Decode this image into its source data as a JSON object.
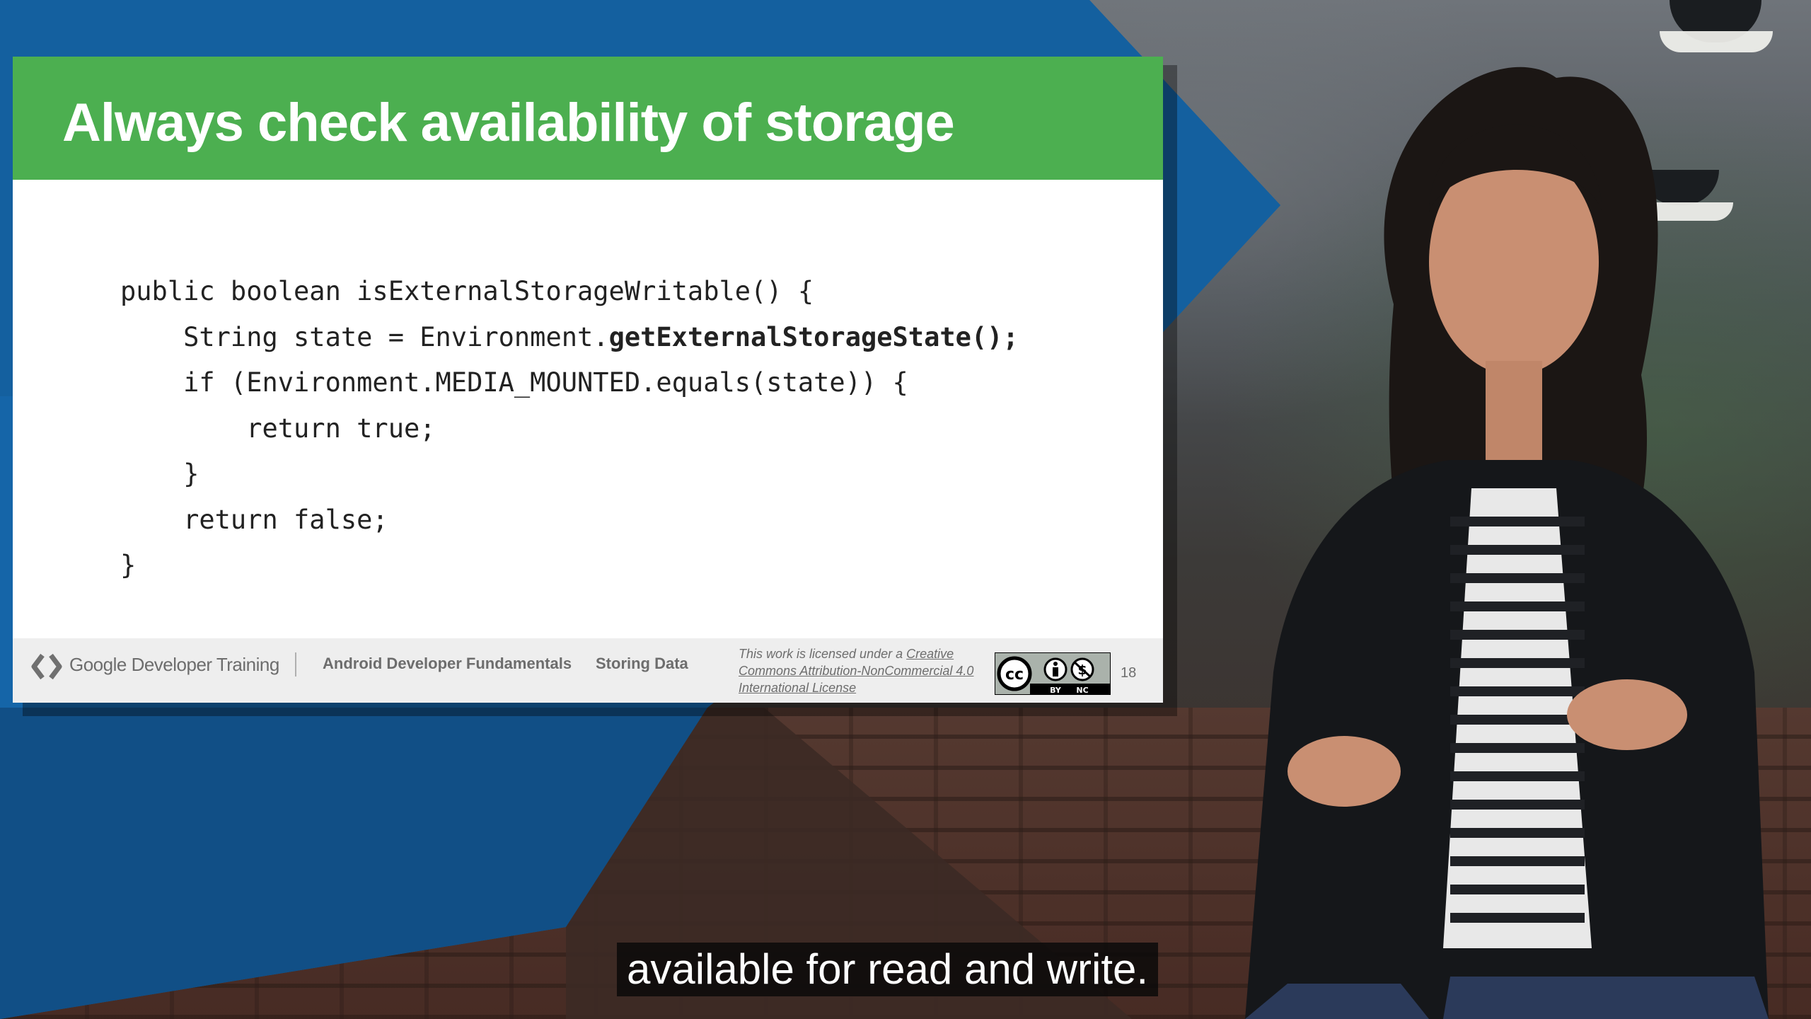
{
  "slide": {
    "title": "Always check availability of storage",
    "code_lines": {
      "l1": "public boolean isExternalStorageWritable() {",
      "l2_pre": "    String state = Environment.",
      "l2_bold": "getExternalStorageState();",
      "l3": "    if (Environment.MEDIA_MOUNTED.equals(state)) {",
      "l4": "        return true;",
      "l5": "    }",
      "l6": "    return false;",
      "l7": "}"
    },
    "footer": {
      "brand": "Google Developer Training",
      "course": "Android Developer Fundamentals",
      "topic": "Storing Data",
      "license_prefix": "This work is licensed under a ",
      "license_link": "Creative Commons Attribution-NonCommercial 4.0 International License",
      "cc_labels": {
        "by": "BY",
        "nc": "NC",
        "cc": "cc"
      },
      "page_number": "18"
    },
    "colors": {
      "header": "#4caf50",
      "accent_blue": "#1565a8"
    }
  },
  "caption": {
    "text": "available for read and write."
  }
}
